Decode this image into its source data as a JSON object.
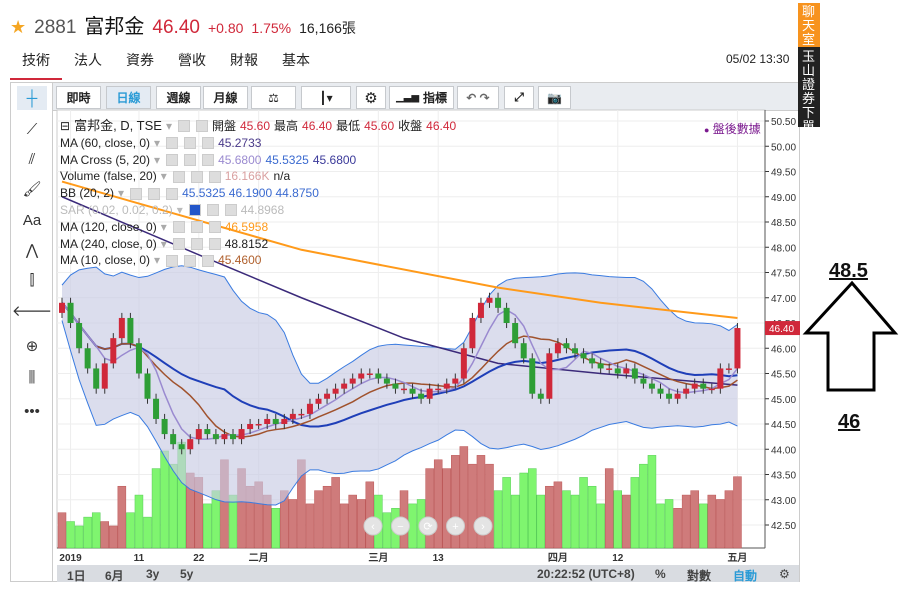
{
  "header": {
    "code": "2881",
    "name": "富邦金",
    "price": "46.40",
    "change": "+0.80",
    "percent": "1.75%",
    "volume": "16,166張"
  },
  "tabs": [
    "技術",
    "法人",
    "資券",
    "營收",
    "財報",
    "基本"
  ],
  "datetime": "05/02 13:30",
  "side_tabs": {
    "chat": "聊天室",
    "order": "玉山證券下單"
  },
  "toolbar": {
    "realtime": "即時",
    "daily": "日線",
    "weekly": "週線",
    "monthly": "月線",
    "indicators": "指標"
  },
  "legend": {
    "title": "富邦金, D, TSE",
    "open_label": "開盤",
    "open": "45.60",
    "high_label": "最高",
    "high": "46.40",
    "low_label": "最低",
    "low": "45.60",
    "close_label": "收盤",
    "close": "46.40",
    "after_hours": "盤後數據",
    "rows": [
      {
        "label": "MA (60, close, 0)",
        "values": [
          "45.2733"
        ]
      },
      {
        "label": "MA Cross (5, 20)",
        "values": [
          "45.6800",
          "45.5325",
          "45.6800"
        ]
      },
      {
        "label": "Volume (false, 20)",
        "values": [
          "16.166K",
          "n/a"
        ]
      },
      {
        "label": "BB (20, 2)",
        "values": [
          "45.5325 46.1900 44.8750"
        ]
      },
      {
        "label": "SAR (0.02, 0.02, 0.2)",
        "values": [
          "44.8968"
        ]
      },
      {
        "label": "MA (120, close, 0)",
        "values": [
          "46.5958"
        ]
      },
      {
        "label": "MA (240, close, 0)",
        "values": [
          "48.8152"
        ]
      },
      {
        "label": "MA (10, close, 0)",
        "values": [
          "45.4600"
        ]
      }
    ]
  },
  "chart_data": {
    "type": "candlestick",
    "ylim": [
      42.25,
      50.6
    ],
    "yticks": [
      "50.50",
      "50.00",
      "49.50",
      "49.00",
      "48.50",
      "48.00",
      "47.50",
      "47.00",
      "46.50",
      "46.00",
      "45.50",
      "45.00",
      "44.50",
      "44.00",
      "43.50",
      "43.00",
      "42.50"
    ],
    "last_price_tag": "46.40",
    "xticks": [
      {
        "i": 1,
        "label": "2019"
      },
      {
        "i": 9,
        "label": "11"
      },
      {
        "i": 16,
        "label": "22"
      },
      {
        "i": 23,
        "label": "二月"
      },
      {
        "i": 37,
        "label": "三月"
      },
      {
        "i": 44,
        "label": "13"
      },
      {
        "i": 58,
        "label": "四月"
      },
      {
        "i": 65,
        "label": "12"
      },
      {
        "i": 79,
        "label": "五月"
      }
    ],
    "closes": [
      46.9,
      46.5,
      46.0,
      45.6,
      45.2,
      45.7,
      46.2,
      46.6,
      46.1,
      45.5,
      45.0,
      44.6,
      44.3,
      44.1,
      44.0,
      44.2,
      44.4,
      44.3,
      44.2,
      44.3,
      44.2,
      44.4,
      44.5,
      44.5,
      44.6,
      44.5,
      44.6,
      44.7,
      44.7,
      44.9,
      45.0,
      45.1,
      45.2,
      45.3,
      45.4,
      45.5,
      45.5,
      45.4,
      45.3,
      45.2,
      45.2,
      45.1,
      45.0,
      45.2,
      45.2,
      45.3,
      45.4,
      46.0,
      46.6,
      46.9,
      47.0,
      46.8,
      46.5,
      46.1,
      45.8,
      45.1,
      45.0,
      45.9,
      46.1,
      46.0,
      45.9,
      45.8,
      45.7,
      45.6,
      45.6,
      45.5,
      45.6,
      45.4,
      45.3,
      45.2,
      45.1,
      45.0,
      45.1,
      45.2,
      45.3,
      45.2,
      45.2,
      45.6,
      45.6,
      46.4
    ],
    "first_open": 46.7,
    "volumes_k": [
      8,
      6,
      5,
      7,
      8,
      6,
      5,
      14,
      8,
      12,
      7,
      18,
      22,
      19,
      24,
      17,
      16,
      10,
      13,
      20,
      12,
      18,
      14,
      15,
      12,
      9,
      13,
      11,
      20,
      10,
      13,
      14,
      16,
      10,
      12,
      11,
      15,
      12,
      8,
      9,
      13,
      10,
      11,
      18,
      20,
      18,
      21,
      23,
      19,
      21,
      19,
      13,
      16,
      12,
      17,
      18,
      12,
      14,
      15,
      13,
      12,
      16,
      14,
      10,
      18,
      13,
      12,
      16,
      19,
      21,
      10,
      11,
      9,
      12,
      13,
      10,
      12,
      11,
      13,
      16.166
    ],
    "ma60": [
      [
        0,
        49.0
      ],
      [
        16,
        47.85
      ],
      [
        28,
        47.0
      ],
      [
        40,
        46.2
      ],
      [
        51,
        45.7
      ],
      [
        63,
        45.5
      ],
      [
        79,
        45.27
      ]
    ],
    "ma120": [
      [
        0,
        49.3
      ],
      [
        28,
        47.95
      ],
      [
        51,
        47.2
      ],
      [
        63,
        46.9
      ],
      [
        79,
        46.6
      ]
    ],
    "volume_ylim": [
      0,
      34
    ]
  },
  "nav_buttons": [
    "‹",
    "−",
    "⟳",
    "+",
    "›"
  ],
  "bottom": {
    "ranges": [
      "1日",
      "6月",
      "3y",
      "5y"
    ],
    "time": "20:22:52 (UTC+8)",
    "percent": "%",
    "log": "對數",
    "auto": "自動"
  },
  "annotations": {
    "target": "48.5",
    "base": "46"
  },
  "colors": {
    "up": "#d0283a",
    "down": "#2e9e36",
    "vol_up": "#cf7b7b",
    "vol_down": "#7ff56f",
    "ma120": "#ff9a1a",
    "ma60": "#3b2a7a",
    "bb": "#3a7be0",
    "bb_fill": "#c8cbe3",
    "ma20": "#1f3fb8",
    "ma5": "#9a8ad0",
    "ma10": "#a0522d"
  }
}
